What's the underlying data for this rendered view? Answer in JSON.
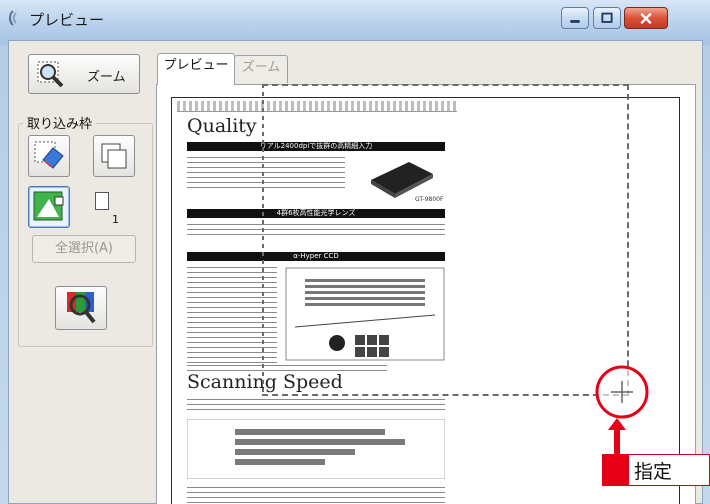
{
  "window": {
    "title": "プレビュー",
    "controls": {
      "minimize": "minimize",
      "maximize": "maximize",
      "close": "close"
    },
    "accent_close": "#d9533a"
  },
  "toolbar": {
    "zoom_label": "ズーム",
    "frame_group_label": "取り込み枠",
    "marquee_count": "1",
    "select_all_label": "全選択(A)"
  },
  "tabs": [
    {
      "label": "プレビュー",
      "active": true
    },
    {
      "label": "ズーム",
      "active": false
    }
  ],
  "document": {
    "heading1": "Quality",
    "bar1": "リアル2400dpiで抜群の高精細入力",
    "bar2": "4群6枚高性能光学レンズ",
    "bar3": "α-Hyper CCD",
    "heading2": "Scanning Speed",
    "scanner_label": "GT-9800F"
  },
  "callout": {
    "label": "指定",
    "color": "#e60017"
  }
}
